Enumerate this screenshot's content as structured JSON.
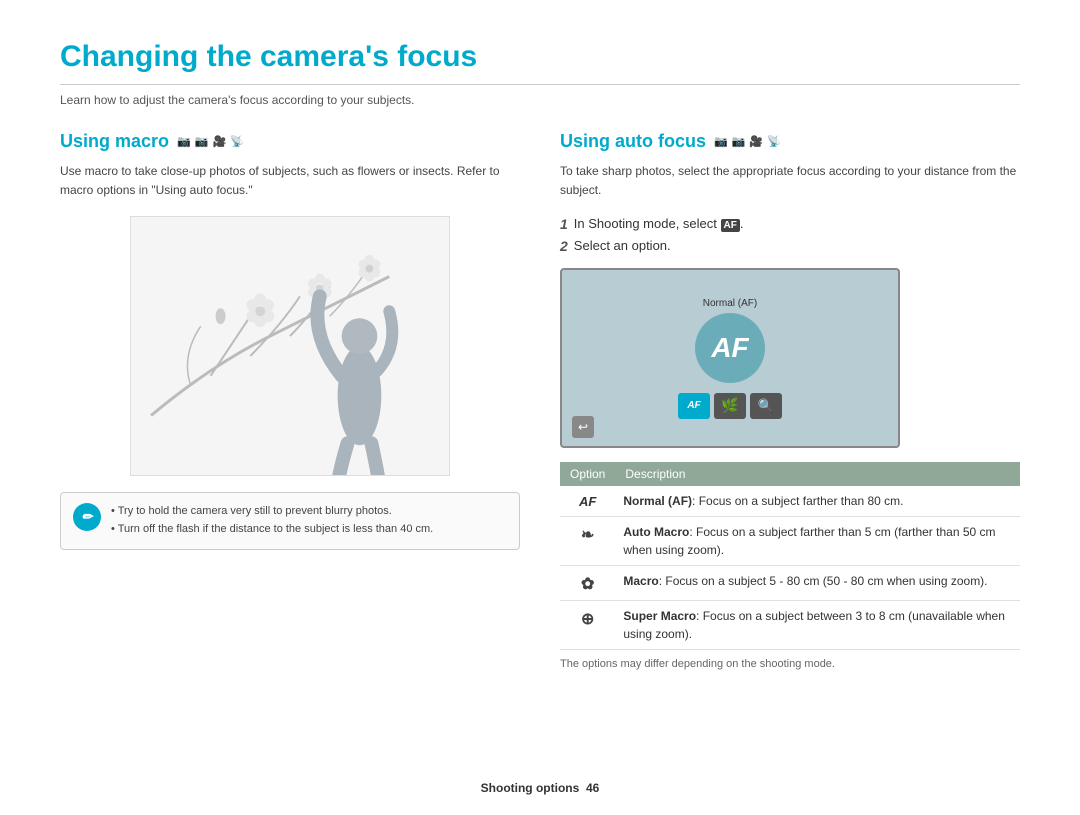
{
  "page": {
    "title": "Changing the camera's focus",
    "subtitle": "Learn how to adjust the camera's focus according to your subjects.",
    "footer_text": "Shooting options",
    "footer_page": "46"
  },
  "macro_section": {
    "title": "Using macro",
    "desc": "Use macro to take close-up photos of subjects, such as flowers or insects. Refer to macro options in \"Using auto focus.\"",
    "tip_line1": "Try to hold the camera very still to prevent blurry photos.",
    "tip_line2": "Turn off the flash if the distance to the subject is less than 40 cm."
  },
  "auto_focus_section": {
    "title": "Using auto focus",
    "desc": "To take sharp photos, select the appropriate focus according to your distance from the subject.",
    "step1": "In Shooting mode, select AF.",
    "step2": "Select an option.",
    "preview_label": "Normal (AF)",
    "preview_af_text": "AF",
    "table": {
      "col1": "Option",
      "col2": "Description",
      "rows": [
        {
          "icon": "AF",
          "icon_type": "text",
          "bold": "Normal (AF)",
          "desc": ": Focus on a subject farther than 80 cm."
        },
        {
          "icon": "⚘",
          "icon_type": "symbol",
          "bold": "Auto Macro",
          "desc": ": Focus on a subject farther than 5 cm (farther than 50 cm when using zoom)."
        },
        {
          "icon": "❀",
          "icon_type": "symbol",
          "bold": "Macro",
          "desc": ": Focus on a subject 5 - 80 cm (50 - 80 cm when using zoom)."
        },
        {
          "icon": "🔍",
          "icon_type": "symbol",
          "bold": "Super Macro",
          "desc": ": Focus on a subject between 3 to 8 cm (unavailable when using zoom)."
        }
      ]
    },
    "table_note": "The options may differ depending on the shooting mode."
  }
}
